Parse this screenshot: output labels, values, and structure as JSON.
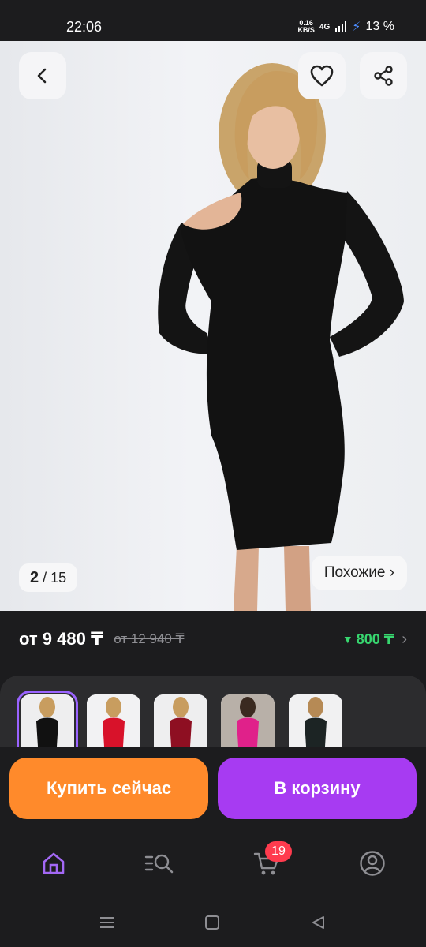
{
  "status": {
    "time": "22:06",
    "speed_value": "0.16",
    "speed_unit": "KB/S",
    "network": "4G",
    "battery": "13 %"
  },
  "gallery": {
    "index": "2",
    "total": "15",
    "similar_label": "Похожие ›"
  },
  "price": {
    "current": "от 9 480 ₸",
    "old": "от 12 940 ₸",
    "bonus": "800 ₸",
    "bonus_arrow": "▼"
  },
  "variants": [
    {
      "name": "black-dress",
      "color": "#111111"
    },
    {
      "name": "red-dress",
      "color": "#d8122a"
    },
    {
      "name": "burgundy-dress",
      "color": "#8e0f22"
    },
    {
      "name": "pink-dress",
      "color": "#e0218a"
    },
    {
      "name": "dark-dress",
      "color": "#1c2424"
    }
  ],
  "actions": {
    "buy_now": "Купить сейчас",
    "add_to_cart": "В корзину"
  },
  "tabs": {
    "cart_badge": "19"
  },
  "colors": {
    "accent_purple": "#a73bf2",
    "accent_orange": "#ff8a2b",
    "bonus_green": "#37d66f",
    "badge_red": "#ff3b4e"
  }
}
